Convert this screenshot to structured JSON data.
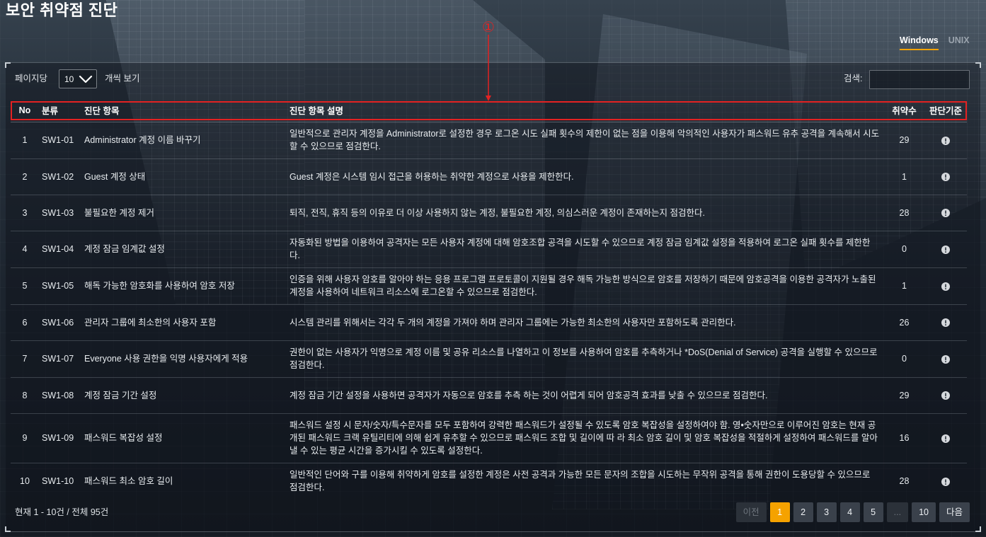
{
  "page": {
    "title": "보안 취약점 진단"
  },
  "annotation": {
    "marker": "①"
  },
  "os_tabs": [
    {
      "label": "Windows",
      "active": true
    },
    {
      "label": "UNIX",
      "active": false
    }
  ],
  "controls": {
    "per_page_label": "페이지당",
    "per_page_value": "10",
    "per_page_suffix": "개씩 보기",
    "search_label": "검색:"
  },
  "table": {
    "columns": {
      "no": "No",
      "category": "분류",
      "item": "진단 항목",
      "description": "진단 항목 설명",
      "vuln_count": "취약수",
      "criteria": "판단기준"
    },
    "rows": [
      {
        "no": 1,
        "code": "SW1-01",
        "item": "Administrator 계정 이름 바꾸기",
        "description": "일반적으로 관리자 계정을 Administrator로 설정한 경우 로그온 시도 실패 횟수의 제한이 없는 점을 이용해 악의적인 사용자가 패스워드 유추 공격을 계속해서 시도할 수 있으므로 점검한다.",
        "vuln_count": 29
      },
      {
        "no": 2,
        "code": "SW1-02",
        "item": "Guest 계정 상태",
        "description": "Guest 계정은 시스템 임시 접근을 허용하는 취약한 계정으로 사용을 제한한다.",
        "vuln_count": 1
      },
      {
        "no": 3,
        "code": "SW1-03",
        "item": "불필요한 계정 제거",
        "description": "퇴직, 전직, 휴직 등의 이유로 더 이상 사용하지 않는 계정, 불필요한 계정, 의심스러운 계정이 존재하는지 점검한다.",
        "vuln_count": 28
      },
      {
        "no": 4,
        "code": "SW1-04",
        "item": "계정 잠금 임계값 설정",
        "description": "자동화된 방법을 이용하여 공격자는 모든 사용자 계정에 대해 암호조합 공격을 시도할 수 있으므로 계정 잠금 임계값 설정을 적용하여 로그온 실패 횟수를 제한한다.",
        "vuln_count": 0
      },
      {
        "no": 5,
        "code": "SW1-05",
        "item": "해독 가능한 암호화를 사용하여 암호 저장",
        "description": "인증을 위해 사용자 암호를 알아야 하는 응용 프로그램 프로토콜이 지원될 경우 해독 가능한 방식으로 암호를 저장하기 때문에 암호공격을 이용한 공격자가 노출된 계정을 사용하여 네트워크 리소스에 로그온할 수 있으므로 점검한다.",
        "vuln_count": 1
      },
      {
        "no": 6,
        "code": "SW1-06",
        "item": "관리자 그룹에 최소한의 사용자 포함",
        "description": "시스템 관리를 위해서는 각각 두 개의 계정을 가져야 하며 관리자 그룹에는 가능한 최소한의 사용자만 포함하도록 관리한다.",
        "vuln_count": 26
      },
      {
        "no": 7,
        "code": "SW1-07",
        "item": "Everyone 사용 권한을 익명 사용자에게 적용",
        "description": "권한이 없는 사용자가 익명으로 계정 이름 및 공유 리소스를 나열하고 이 정보를 사용하여 암호를 추측하거나 *DoS(Denial of Service) 공격을 실행할 수 있으므로 점검한다.",
        "vuln_count": 0
      },
      {
        "no": 8,
        "code": "SW1-08",
        "item": "계정 잠금 기간 설정",
        "description": "계정 잠금 기간 설정을 사용하면 공격자가 자동으로 암호를 추측 하는 것이 어렵게 되어 암호공격 효과를 낮출 수 있으므로 점검한다.",
        "vuln_count": 29
      },
      {
        "no": 9,
        "code": "SW1-09",
        "item": "패스워드 복잡성 설정",
        "description": "패스워드 설정 시 문자/숫자/특수문자를 모두 포함하여 강력한 패스워드가 설정될 수 있도록 암호 복잡성을 설정하여야 함. 영•숫자만으로 이루어진 암호는 현재 공개된 패스워드 크랙 유틸리티에 의해 쉽게 유추할 수 있으므로 패스워드 조합 및 길이에 따 라 최소 암호 길이 및 암호 복잡성을 적절하게 설정하여 패스워드를 알아낼 수 있는 평균 시간을 증가시킬 수 있도록 설정한다.",
        "vuln_count": 16
      },
      {
        "no": 10,
        "code": "SW1-10",
        "item": "패스워드 최소 암호 길이",
        "description": "일반적인 단어와 구를 이용해 취약하게 암호를 설정한 계정은 사전 공격과 가능한 모든 문자의 조합을 시도하는 무작위 공격을 통해 권한이 도용당할 수 있으므로 점검한다.",
        "vuln_count": 28
      }
    ]
  },
  "footer": {
    "summary": "현재 1 - 10건 / 전체 95건"
  },
  "pagination": {
    "prev": {
      "label": "이전",
      "disabled": true
    },
    "pages": [
      {
        "label": "1",
        "active": true
      },
      {
        "label": "2"
      },
      {
        "label": "3"
      },
      {
        "label": "4"
      },
      {
        "label": "5"
      },
      {
        "label": "...",
        "disabled": true
      },
      {
        "label": "10"
      }
    ],
    "next": {
      "label": "다음"
    }
  },
  "icons": {
    "per_page_select": "chevron-down-icon",
    "criteria": "info-icon"
  },
  "colors": {
    "accent": "#f5a200",
    "annotation": "#e32222",
    "inactive_tab": "#9aa3ad"
  }
}
